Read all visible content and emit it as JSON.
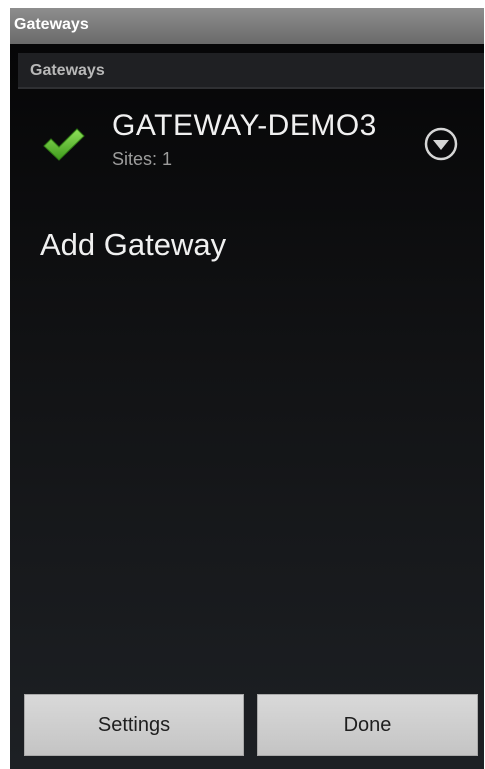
{
  "window": {
    "title": "Gateways"
  },
  "section": {
    "header": "Gateways"
  },
  "gateways": [
    {
      "name": "GATEWAY-DEMO3",
      "subtitle": "Sites: 1",
      "status_icon": "checkmark-icon",
      "expand_icon": "chevron-down-circle-icon"
    }
  ],
  "actions": {
    "add_gateway_label": "Add Gateway"
  },
  "buttons": {
    "settings_label": "Settings",
    "done_label": "Done"
  },
  "colors": {
    "check_green": "#5cbf2a",
    "title_bar": "#7a7a7a",
    "button_face": "#cfcfcf",
    "background_dark": "#0e0f11"
  }
}
